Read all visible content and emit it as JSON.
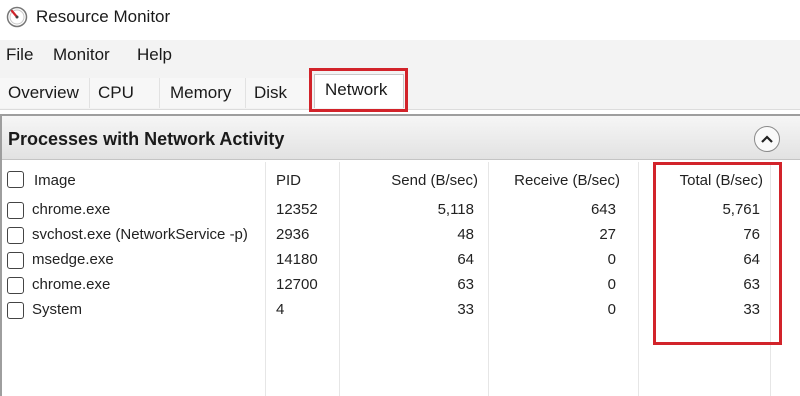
{
  "window": {
    "title": "Resource Monitor"
  },
  "menu": {
    "items": [
      "File",
      "Monitor",
      "Help"
    ]
  },
  "tabs": [
    "Overview",
    "CPU",
    "Memory",
    "Disk",
    "Network"
  ],
  "active_tab": "Network",
  "panel": {
    "title": "Processes with Network Activity",
    "columns": [
      "Image",
      "PID",
      "Send (B/sec)",
      "Receive (B/sec)",
      "Total (B/sec)"
    ],
    "rows": [
      {
        "image": "chrome.exe",
        "pid": "12352",
        "send": "5,118",
        "receive": "643",
        "total": "5,761"
      },
      {
        "image": "svchost.exe (NetworkService -p)",
        "pid": "2936",
        "send": "48",
        "receive": "27",
        "total": "76"
      },
      {
        "image": "msedge.exe",
        "pid": "14180",
        "send": "64",
        "receive": "0",
        "total": "64"
      },
      {
        "image": "chrome.exe",
        "pid": "12700",
        "send": "63",
        "receive": "0",
        "total": "63"
      },
      {
        "image": "System",
        "pid": "4",
        "send": "33",
        "receive": "0",
        "total": "33"
      }
    ]
  },
  "colors": {
    "highlight": "#d2232a"
  },
  "icons": {
    "app": "resource-monitor-gauge-icon",
    "collapse": "chevron-up-icon"
  }
}
